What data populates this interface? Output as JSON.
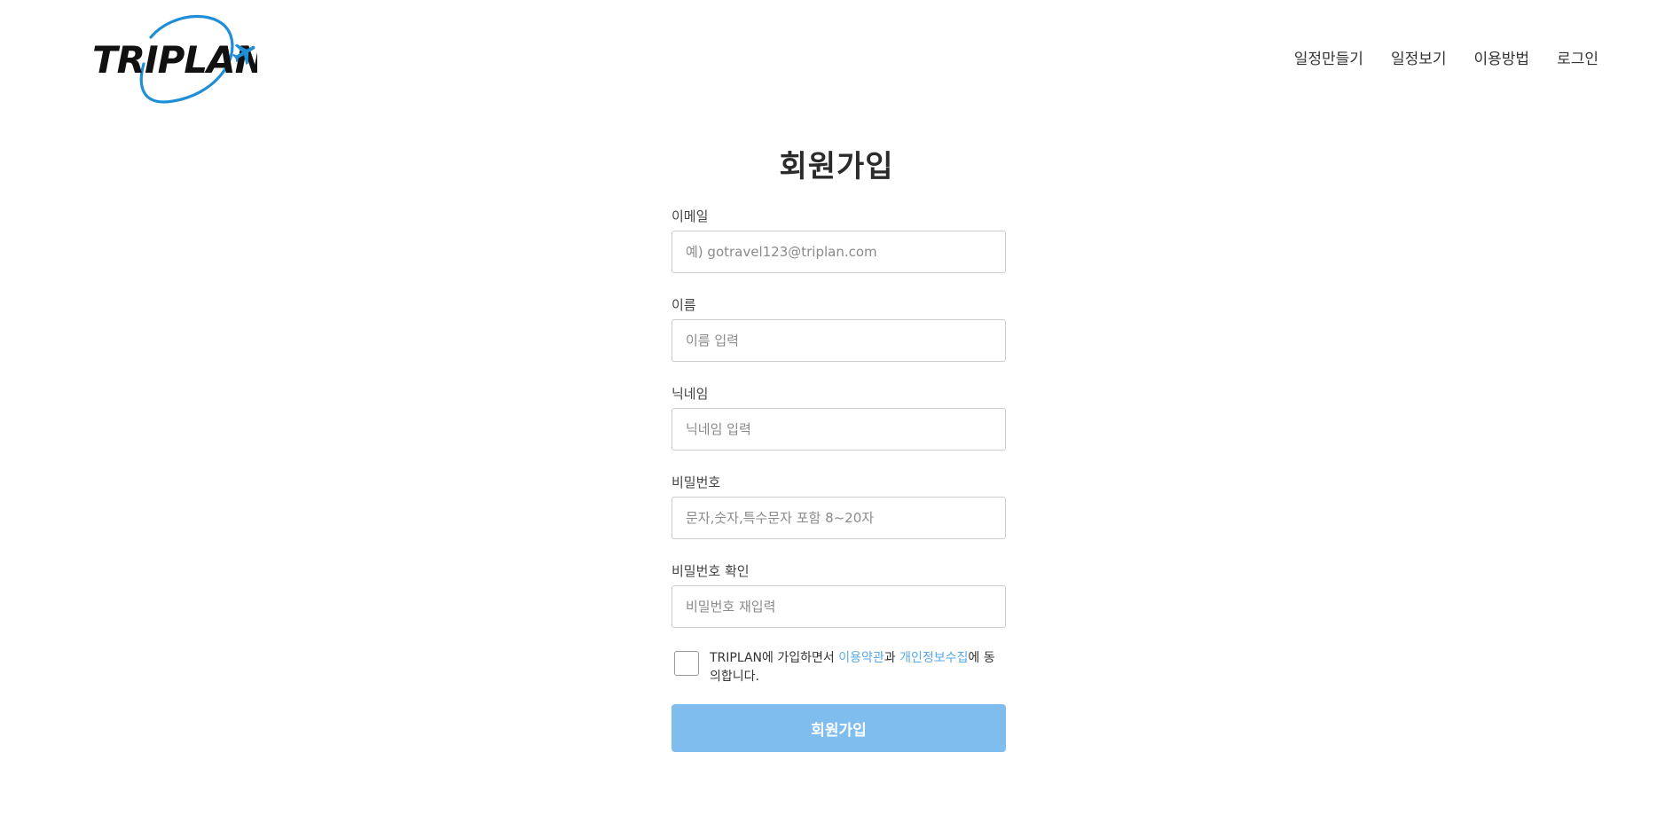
{
  "header": {
    "logo_text": "TRIPLAN",
    "nav": [
      {
        "label": "일정만들기"
      },
      {
        "label": "일정보기"
      },
      {
        "label": "이용방법"
      },
      {
        "label": "로그인"
      }
    ]
  },
  "form": {
    "title": "회원가입",
    "fields": [
      {
        "label": "이메일",
        "placeholder": "예) gotravel123@triplan.com",
        "value": ""
      },
      {
        "label": "이름",
        "placeholder": "이름 입력",
        "value": ""
      },
      {
        "label": "닉네임",
        "placeholder": "닉네임 입력",
        "value": ""
      },
      {
        "label": "비밀번호",
        "placeholder": "문자,숫자,특수문자 포함 8~20자",
        "value": ""
      },
      {
        "label": "비밀번호 확인",
        "placeholder": "비밀번호 재입력",
        "value": ""
      }
    ],
    "agreement": {
      "checked": false,
      "prefix": "TRIPLAN에 가입하면서 ",
      "terms_link": "이용약관",
      "conj": "과 ",
      "privacy_link": "개인정보수집",
      "suffix": "에 동의합니다."
    },
    "submit_label": "회원가입"
  },
  "colors": {
    "accent": "#80bdef",
    "link": "#5aa8e8",
    "logo_ring": "#1e8fd6"
  },
  "icons": {
    "logo_plane": "airplane-icon"
  }
}
